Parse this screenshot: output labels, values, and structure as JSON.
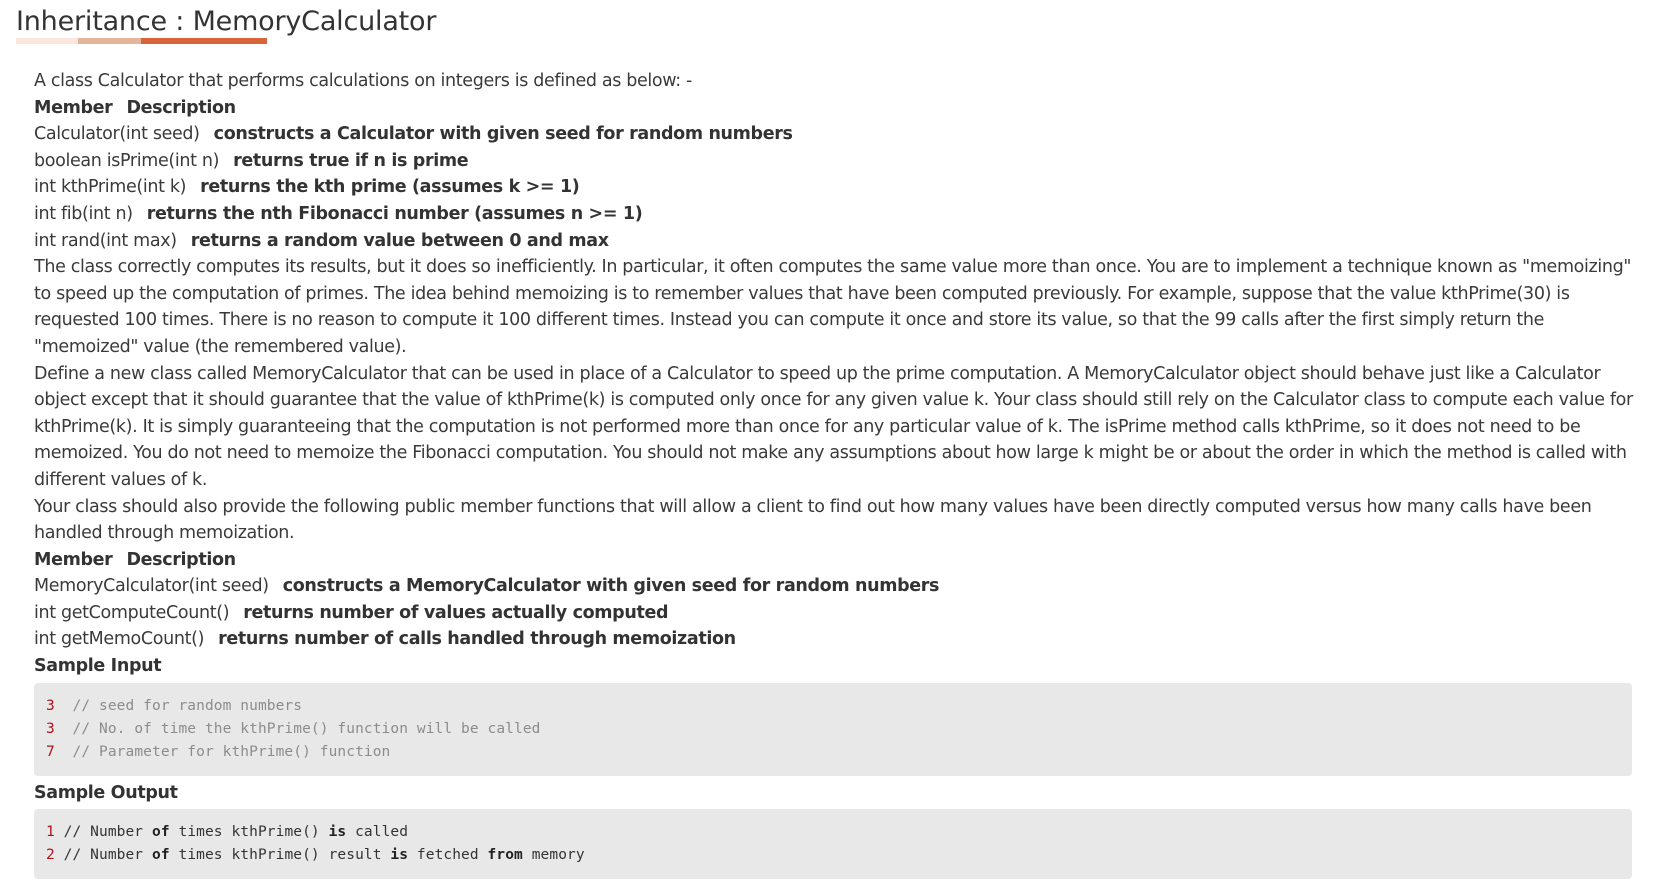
{
  "title": "Inheritance : MemoryCalculator",
  "intro": "A class Calculator that performs calculations on integers is defined as below: -",
  "table1": {
    "header_member": "Member",
    "header_description": "Description",
    "rows": [
      {
        "member": "Calculator(int seed)",
        "description": "constructs a Calculator with given seed for random numbers"
      },
      {
        "member": "boolean isPrime(int n)",
        "description": "returns true if n is prime"
      },
      {
        "member": "int kthPrime(int k)",
        "description": "returns the kth prime (assumes k >= 1)"
      },
      {
        "member": "int fib(int n)",
        "description": "returns the nth Fibonacci number (assumes n >= 1)"
      },
      {
        "member": "int rand(int max)",
        "description": "returns a random value between 0 and max"
      }
    ]
  },
  "paragraphs": [
    "The class correctly computes its results, but it does so inefficiently. In particular, it often computes the same value more than once. You are to implement a technique known as \"memoizing\" to speed up the computation of primes. The idea behind memoizing is to remember values that have been computed previously. For example, suppose that the value kthPrime(30) is requested 100 times. There is no reason to compute it 100 different times. Instead you can compute it once and store its value, so that the 99 calls after the first simply return the \"memoized\" value (the remembered value).",
    "Define a new class called MemoryCalculator that can be used in place of a Calculator to speed up the prime computation. A MemoryCalculator object should behave just like a Calculator object except that it should guarantee that the value of kthPrime(k) is computed only once for any given value k. Your class should still rely on the Calculator class to compute each value for kthPrime(k). It is simply guaranteeing that the computation is not performed more than once for any particular value of k. The isPrime method calls kthPrime, so it does not need to be memoized. You do not need to memoize the Fibonacci computation. You should not make any assumptions about how large k might be or about the order in which the method is called with different values of k.",
    "Your class should also provide the following public member functions that will allow a client to find out how many values have been directly computed versus how many calls have been handled through memoization."
  ],
  "table2": {
    "header_member": "Member",
    "header_description": "Description",
    "rows": [
      {
        "member": "MemoryCalculator(int seed)",
        "description": "constructs a MemoryCalculator with given seed for random numbers"
      },
      {
        "member": "int getComputeCount()",
        "description": "returns number of values actually computed"
      },
      {
        "member": "int getMemoCount()",
        "description": "returns number of calls handled through memoization"
      }
    ]
  },
  "sample_input": {
    "heading": "Sample Input",
    "lines": [
      {
        "value": "3",
        "comment": "// seed for random numbers"
      },
      {
        "value": "3",
        "comment": "// No. of time the kthPrime() function will be called"
      },
      {
        "value": "7",
        "comment": "// Parameter for kthPrime() function"
      }
    ]
  },
  "sample_output": {
    "heading": "Sample Output",
    "lines": [
      {
        "value": "1",
        "p1": " // Number ",
        "k1": "of",
        "p2": " times kthPrime() ",
        "k2": "is",
        "p3": " called",
        "k3": "",
        "p4": ""
      },
      {
        "value": "2",
        "p1": " // Number ",
        "k1": "of",
        "p2": " times kthPrime() result ",
        "k2": "is",
        "p3": " fetched ",
        "k3": "from",
        "p4": " memory"
      }
    ]
  },
  "colors": {
    "accent": "#d9643a",
    "code_background": "#e8e8e8",
    "code_number": "#b0121b",
    "code_comment": "#8c8c8c"
  }
}
